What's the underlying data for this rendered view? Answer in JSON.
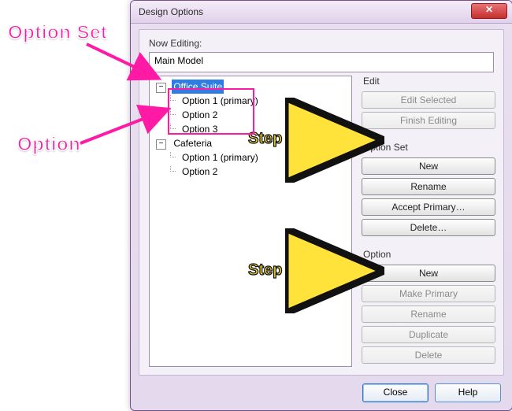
{
  "dialog": {
    "title": "Design Options",
    "close_glyph": "✕",
    "now_editing_label": "Now Editing:",
    "root_model": "Main Model"
  },
  "tree": {
    "sets": [
      {
        "name": "Office Suite",
        "selected": true,
        "options": [
          "Option 1 (primary)",
          "Option 2",
          "Option 3"
        ]
      },
      {
        "name": "Cafeteria",
        "selected": false,
        "options": [
          "Option 1 (primary)",
          "Option 2"
        ]
      }
    ]
  },
  "panels": {
    "edit": {
      "title": "Edit",
      "edit_selected": "Edit Selected",
      "finish_editing": "Finish Editing"
    },
    "option_set": {
      "title": "Option Set",
      "new": "New",
      "rename": "Rename",
      "accept_primary": "Accept Primary…",
      "delete": "Delete…"
    },
    "option": {
      "title": "Option",
      "new": "New",
      "make_primary": "Make Primary",
      "rename": "Rename",
      "duplicate": "Duplicate",
      "delete": "Delete"
    }
  },
  "footer": {
    "close": "Close",
    "help": "Help"
  },
  "annotations": {
    "callout_set": "Option Set",
    "callout_option": "Option",
    "step1": "Step 1",
    "step2": "Step 2"
  }
}
